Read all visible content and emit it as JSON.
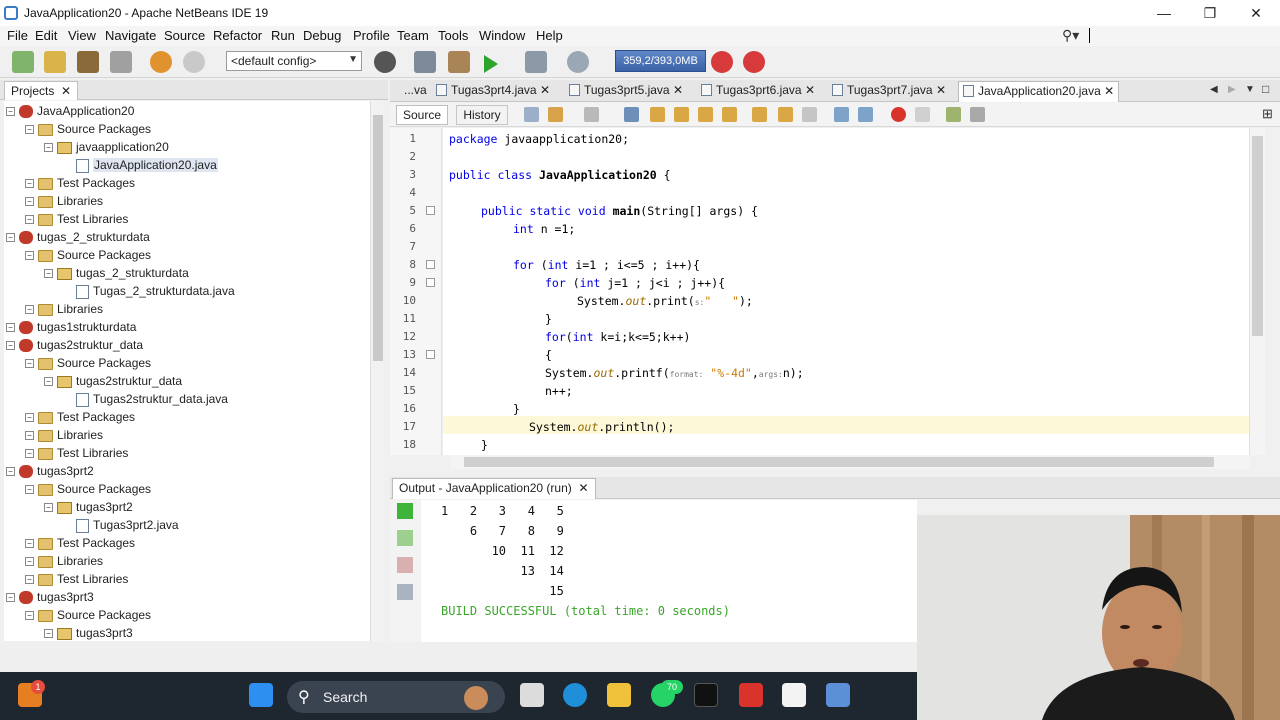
{
  "window": {
    "title": "JavaApplication20 - Apache NetBeans IDE 19"
  },
  "window_controls": {
    "minimize": "—",
    "maximize": "❐",
    "close": "✕"
  },
  "menu": [
    "File",
    "Edit",
    "View",
    "Navigate",
    "Source",
    "Refactor",
    "Run",
    "Debug",
    "Profile",
    "Team",
    "Tools",
    "Window",
    "Help"
  ],
  "toolbar": {
    "config": "<default config>",
    "memory": "359,2/393,0MB",
    "icons": [
      "new-file-icon",
      "new-project-icon",
      "open-project-icon",
      "close-project-icon",
      "undo-icon",
      "redo-icon",
      "globe-icon",
      "build-icon",
      "clean-build-icon",
      "run-icon",
      "debug-icon",
      "profile-icon",
      "gc-icon",
      "gc2-icon"
    ]
  },
  "projects_panel": {
    "tab_label": "Projects",
    "tree": [
      {
        "label": "JavaApplication20",
        "type": "proj",
        "depth": 0
      },
      {
        "label": "Source Packages",
        "type": "folder",
        "depth": 1
      },
      {
        "label": "javaapplication20",
        "type": "pkg",
        "depth": 2
      },
      {
        "label": "JavaApplication20.java",
        "type": "java",
        "depth": 3,
        "selected": true
      },
      {
        "label": "Test Packages",
        "type": "folder",
        "depth": 1
      },
      {
        "label": "Libraries",
        "type": "folder",
        "depth": 1
      },
      {
        "label": "Test Libraries",
        "type": "folder",
        "depth": 1
      },
      {
        "label": "tugas_2_strukturdata",
        "type": "proj",
        "depth": 0
      },
      {
        "label": "Source Packages",
        "type": "folder",
        "depth": 1
      },
      {
        "label": "tugas_2_strukturdata",
        "type": "pkg",
        "depth": 2
      },
      {
        "label": "Tugas_2_strukturdata.java",
        "type": "java",
        "depth": 3
      },
      {
        "label": "Libraries",
        "type": "folder",
        "depth": 1
      },
      {
        "label": "tugas1strukturdata",
        "type": "proj",
        "depth": 0
      },
      {
        "label": "tugas2struktur_data",
        "type": "proj",
        "depth": 0
      },
      {
        "label": "Source Packages",
        "type": "folder",
        "depth": 1
      },
      {
        "label": "tugas2struktur_data",
        "type": "pkg",
        "depth": 2
      },
      {
        "label": "Tugas2struktur_data.java",
        "type": "java",
        "depth": 3
      },
      {
        "label": "Test Packages",
        "type": "folder",
        "depth": 1
      },
      {
        "label": "Libraries",
        "type": "folder",
        "depth": 1
      },
      {
        "label": "Test Libraries",
        "type": "folder",
        "depth": 1
      },
      {
        "label": "tugas3prt2",
        "type": "proj",
        "depth": 0
      },
      {
        "label": "Source Packages",
        "type": "folder",
        "depth": 1
      },
      {
        "label": "tugas3prt2",
        "type": "pkg",
        "depth": 2
      },
      {
        "label": "Tugas3prt2.java",
        "type": "java",
        "depth": 3
      },
      {
        "label": "Test Packages",
        "type": "folder",
        "depth": 1
      },
      {
        "label": "Libraries",
        "type": "folder",
        "depth": 1
      },
      {
        "label": "Test Libraries",
        "type": "folder",
        "depth": 1
      },
      {
        "label": "tugas3prt3",
        "type": "proj",
        "depth": 0
      },
      {
        "label": "Source Packages",
        "type": "folder",
        "depth": 1
      },
      {
        "label": "tugas3prt3",
        "type": "pkg",
        "depth": 2
      }
    ]
  },
  "editor_tabs": [
    "...va",
    "Tugas3prt4.java",
    "Tugas3prt5.java",
    "Tugas3prt6.java",
    "Tugas3prt7.java",
    "JavaApplication20.java"
  ],
  "active_tab": "JavaApplication20.java",
  "editor_toolbar": {
    "source": "Source",
    "history": "History"
  },
  "code": {
    "line_numbers": [
      "1",
      "2",
      "3",
      "4",
      "5",
      "6",
      "7",
      "8",
      "9",
      "10",
      "11",
      "12",
      "13",
      "14",
      "15",
      "16",
      "17",
      "18"
    ],
    "l1": {
      "kw": "package",
      "rest": " javaapplication20;"
    },
    "l3": {
      "kw": "public class",
      "name": "JavaApplication20",
      "rest": " {"
    },
    "l5": {
      "kw": "public static void",
      "name": "main",
      "rest": "(String[] args) {"
    },
    "l6": {
      "kw": "int",
      "rest": " n =1;"
    },
    "l8": {
      "kw1": "for",
      "mid": " (",
      "kw2": "int",
      "rest": " i=1 ; i<=5 ; i++){"
    },
    "l9": {
      "kw1": "for",
      "mid": " (",
      "kw2": "int",
      "rest": " j=1 ; j<i ; j++){"
    },
    "l10": {
      "pre": "System.",
      "field": "out",
      "call": ".print(",
      "hint": "s:",
      "str": "\"   \"",
      "end": ");"
    },
    "l11": "}",
    "l12": {
      "kw1": "for",
      "mid": "(",
      "kw2": "int",
      "rest": " k=i;k<=5;k++)"
    },
    "l13": "{",
    "l14": {
      "pre": "System.",
      "field": "out",
      "call": ".printf(",
      "hint1": "format:",
      "str": "\"%-4d\"",
      "hint2": "args:",
      "end": "n);"
    },
    "l15": "n++;",
    "l16": "}",
    "l17": {
      "pre": "System.",
      "field": "out",
      "call": ".println",
      "end": "();"
    },
    "l18": "}"
  },
  "output": {
    "tab_label": "Output - JavaApplication20 (run)",
    "lines": [
      "1   2   3   4   5",
      "    6   7   8   9",
      "       10  11  12",
      "           13  14",
      "               15"
    ],
    "build": "BUILD SUCCESSFUL (total time: 0 seconds)"
  },
  "taskbar": {
    "search": "Search",
    "notify_badge": "1",
    "whatsapp_badge": "70"
  },
  "colors": {
    "keyword": "#0000e6",
    "string": "#ce7b00",
    "field": "#9b6a00",
    "success": "#38a628",
    "memory": "#4a72b8"
  }
}
